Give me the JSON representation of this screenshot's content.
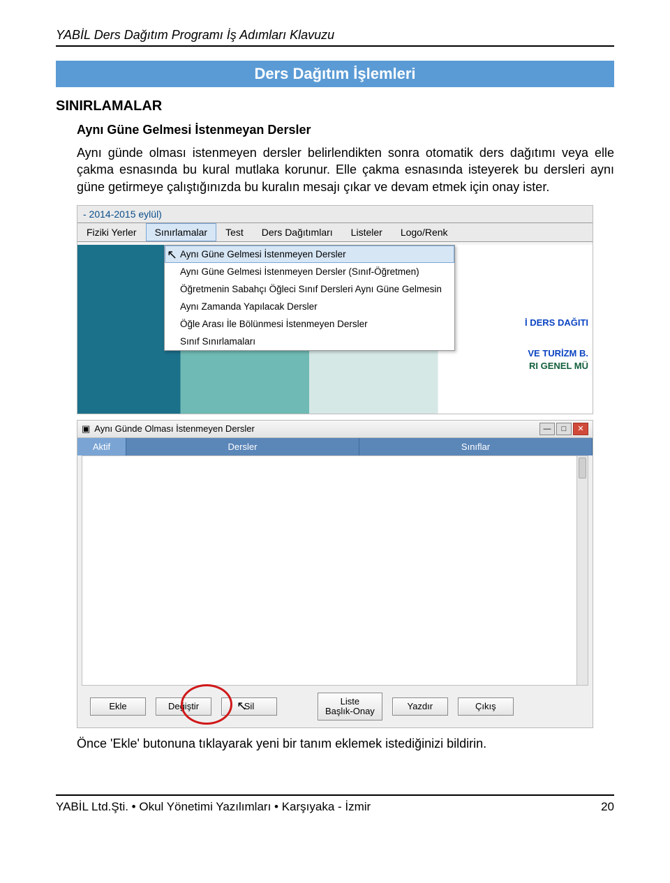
{
  "doc_header": "YABİL Ders Dağıtım Programı İş Adımları Klavuzu",
  "banner": "Ders Dağıtım İşlemleri",
  "section_h2": "SINIRLAMALAR",
  "section_h3": "Aynı Güne Gelmesi İstenmeyan Dersler",
  "paragraph": "Aynı günde olması istenmeyen dersler belirlendikten sonra otomatik ders dağıtımı veya elle çakma esnasında bu kural mutlaka korunur. Elle çakma esnasında isteyerek bu dersleri aynı güne getirmeye çalıştığınızda bu kuralın mesajı çıkar ve devam etmek için onay ister.",
  "screenshot1": {
    "title_year": "- 2014-2015 eylül)",
    "menus": {
      "m1": "Fiziki Yerler",
      "m2": "Sınırlamalar",
      "m3": "Test",
      "m4": "Ders Dağıtımları",
      "m5": "Listeler",
      "m6": "Logo/Renk"
    },
    "dropdown": {
      "i1": "Aynı Güne Gelmesi İstenmeyen Dersler",
      "i2": "Aynı Güne Gelmesi İstenmeyen Dersler (Sınıf-Öğretmen)",
      "i3": "Öğretmenin Sabahçı Öğleci Sınıf Dersleri Aynı Güne Gelmesin",
      "i4": "Aynı Zamanda Yapılacak Dersler",
      "i5": "Öğle Arası İle Bölünmesi İstenmeyen Dersler",
      "i6": "Sınıf Sınırlamaları"
    },
    "side": {
      "s1": "İ DERS DAĞITI",
      "s2": "VE TURİZM B.",
      "s3": "RI GENEL MÜ"
    }
  },
  "screenshot2": {
    "window_title": "Aynı Günde Olması İstenmeyen Dersler",
    "tabs": {
      "t1": "Aktif",
      "t2": "Dersler",
      "t3": "Sınıflar"
    },
    "buttons": {
      "b1": "Ekle",
      "b2": "Değiştir",
      "b3": "Sil",
      "b4": "Liste\nBaşlık-Onay",
      "b5": "Yazdır",
      "b6": "Çıkış"
    },
    "win_controls": {
      "min": "—",
      "max": "□",
      "close": "✕"
    }
  },
  "post_text": "Önce 'Ekle' butonuna tıklayarak yeni bir tanım eklemek istediğinizi bildirin.",
  "footer_left": "YABİL Ltd.Şti. • Okul Yönetimi Yazılımları • Karşıyaka - İzmir",
  "footer_page": "20"
}
